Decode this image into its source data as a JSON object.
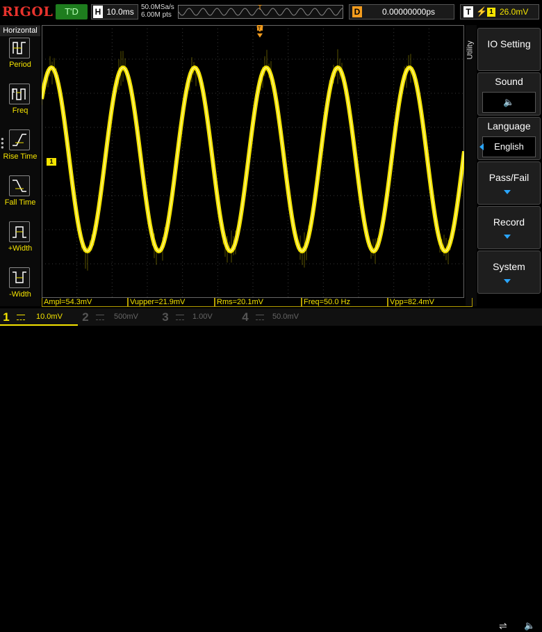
{
  "header": {
    "logo": "RIGOL",
    "run_state": "T'D",
    "horizontal_label": "H",
    "timebase": "10.0ms",
    "sample_rate": "50.0MSa/s",
    "memory_depth": "6.00M pts",
    "delay_label": "D",
    "delay_value": "0.00000000ps",
    "trigger_label": "T",
    "trigger_source": "1",
    "trigger_level": "26.0mV"
  },
  "left_menu": {
    "title": "Horizontal",
    "items": [
      {
        "label": "Period",
        "icon": "period-icon"
      },
      {
        "label": "Freq",
        "icon": "frequency-icon"
      },
      {
        "label": "Rise Time",
        "icon": "rise-time-icon"
      },
      {
        "label": "Fall Time",
        "icon": "fall-time-icon"
      },
      {
        "label": "+Width",
        "icon": "positive-width-icon"
      },
      {
        "label": "-Width",
        "icon": "negative-width-icon"
      }
    ]
  },
  "right_menu": {
    "side_label": "Utility",
    "io_setting": "IO Setting",
    "sound": "Sound",
    "language": "Language",
    "language_value": "English",
    "pass_fail": "Pass/Fail",
    "record": "Record",
    "system": "System"
  },
  "measurements": [
    {
      "text": "Ampl=54.3mV"
    },
    {
      "text": "Vupper=21.9mV"
    },
    {
      "text": "Rms=20.1mV"
    },
    {
      "text": "Freq=50.0 Hz"
    },
    {
      "text": "Vpp=82.4mV"
    }
  ],
  "channels": [
    {
      "num": "1",
      "scale": "10.0mV",
      "color": "#f5e400",
      "active": true
    },
    {
      "num": "2",
      "scale": "500mV",
      "color": "#555555",
      "active": false
    },
    {
      "num": "3",
      "scale": "1.00V",
      "color": "#555555",
      "active": false
    },
    {
      "num": "4",
      "scale": "50.0mV",
      "color": "#555555",
      "active": false
    }
  ],
  "ch1_marker": "1",
  "waveform": {
    "type": "sine",
    "channel": "1",
    "cycles_visible": 6,
    "color": "#f5e400"
  },
  "colors": {
    "trace": "#f5e400",
    "trigger": "#f39c1e",
    "accent": "#2aa6ff",
    "logo": "#e8332d"
  }
}
